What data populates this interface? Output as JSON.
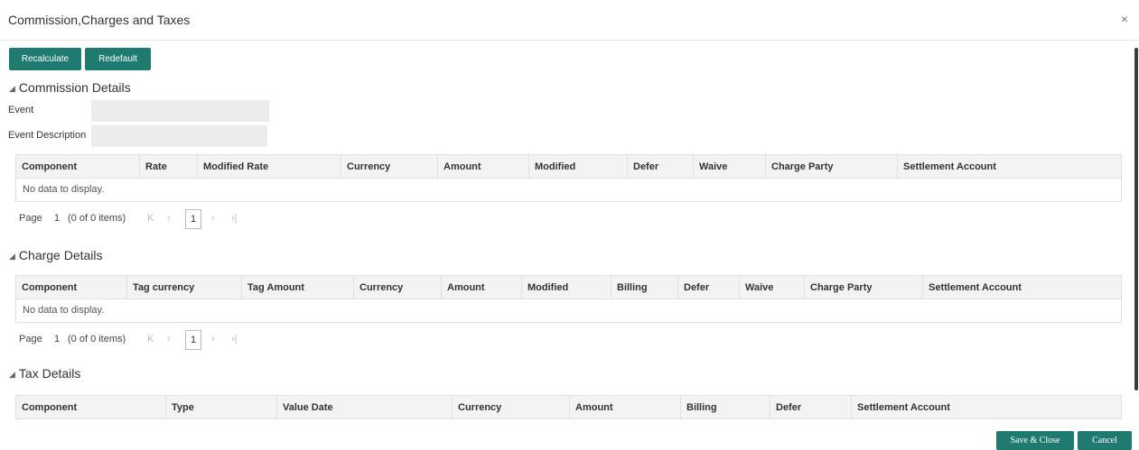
{
  "dialog": {
    "title": "Commission,Charges and Taxes",
    "close_glyph": "×"
  },
  "toolbar": {
    "recalculate_label": "Recalculate",
    "redefault_label": "Redefault"
  },
  "commission": {
    "section_title": "Commission Details",
    "event_label": "Event",
    "event_value": "",
    "event_description_label": "Event Description",
    "event_description_value": "",
    "columns": [
      "Component",
      "Rate",
      "Modified Rate",
      "Currency",
      "Amount",
      "Modified",
      "Defer",
      "Waive",
      "Charge Party",
      "Settlement Account"
    ],
    "empty_text": "No data to display.",
    "pager": {
      "page_label": "Page",
      "page_number": "1",
      "items_text": "(0 of 0 items)",
      "current_page": "1"
    }
  },
  "charges": {
    "section_title": "Charge Details",
    "columns": [
      "Component",
      "Tag currency",
      "Tag Amount",
      "Currency",
      "Amount",
      "Modified",
      "Billing",
      "Defer",
      "Waive",
      "Charge Party",
      "Settlement Account"
    ],
    "empty_text": "No data to display.",
    "pager": {
      "page_label": "Page",
      "page_number": "1",
      "items_text": "(0 of 0 items)",
      "current_page": "1"
    }
  },
  "taxes": {
    "section_title": "Tax Details",
    "columns": [
      "Component",
      "Type",
      "Value Date",
      "Currency",
      "Amount",
      "Billing",
      "Defer",
      "Settlement Account"
    ]
  },
  "footer": {
    "save_close_label": "Save & Close",
    "cancel_label": "Cancel"
  },
  "icons": {
    "collapse": "◢",
    "first": "K",
    "prev": "‹",
    "next": "›",
    "last": "›|"
  },
  "colors": {
    "accent": "#1f7a70",
    "header_bg": "#f3f3f3",
    "field_bg": "#ececec"
  }
}
